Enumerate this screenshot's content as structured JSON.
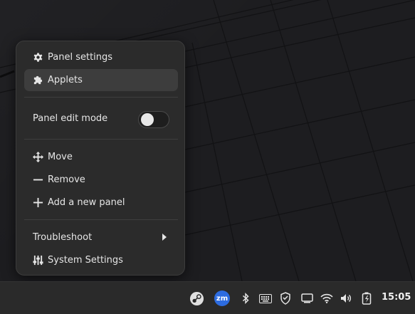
{
  "menu": {
    "panel_settings": "Panel settings",
    "applets": "Applets",
    "panel_edit_mode": "Panel edit mode",
    "panel_edit_mode_on": false,
    "move": "Move",
    "remove": "Remove",
    "add_new_panel": "Add a new panel",
    "troubleshoot": "Troubleshoot",
    "system_settings": "System Settings"
  },
  "taskbar": {
    "zoom_label": "zm",
    "clock": "15:05",
    "tray_icons": [
      "steam-icon",
      "zoom-icon",
      "bluetooth-icon",
      "keyboard-icon",
      "shield-icon",
      "display-icon",
      "wifi-icon",
      "volume-icon",
      "battery-icon"
    ]
  },
  "colors": {
    "menu_bg": "#2b2b2b",
    "highlight": "#3d3d3d",
    "taskbar_bg": "#2a2a2a",
    "zoom_blue": "#2d6ce0"
  }
}
